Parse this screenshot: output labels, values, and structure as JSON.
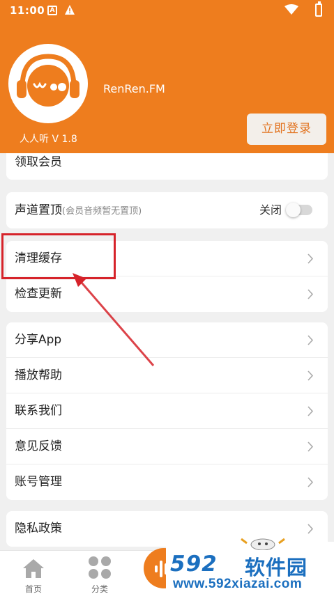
{
  "status_bar": {
    "time": "11:00",
    "icon_a": "A"
  },
  "header": {
    "app_name": "RenRen.FM",
    "version": "人人听 V 1.8",
    "login_button": "立即登录",
    "accent_color": "#ee7d1e"
  },
  "menu": {
    "vip": {
      "label": "领取会员"
    },
    "channel_top": {
      "label": "声道置顶",
      "note": "(会员音频暂无置顶)",
      "value": "关闭"
    },
    "clear_cache": {
      "label": "清理缓存"
    },
    "check_update": {
      "label": "检查更新"
    },
    "share_app": {
      "label": "分享App"
    },
    "play_help": {
      "label": "播放帮助"
    },
    "contact_us": {
      "label": "联系我们"
    },
    "feedback": {
      "label": "意见反馈"
    },
    "account_mgmt": {
      "label": "账号管理"
    },
    "privacy": {
      "label": "隐私政策"
    }
  },
  "tabbar": {
    "home": {
      "label": "首页",
      "icon": "home-icon"
    },
    "category": {
      "label": "分类",
      "icon": "grid-icon"
    }
  },
  "watermark": {
    "number": "592",
    "text": "软件园",
    "url": "www.592xiazai.com"
  }
}
